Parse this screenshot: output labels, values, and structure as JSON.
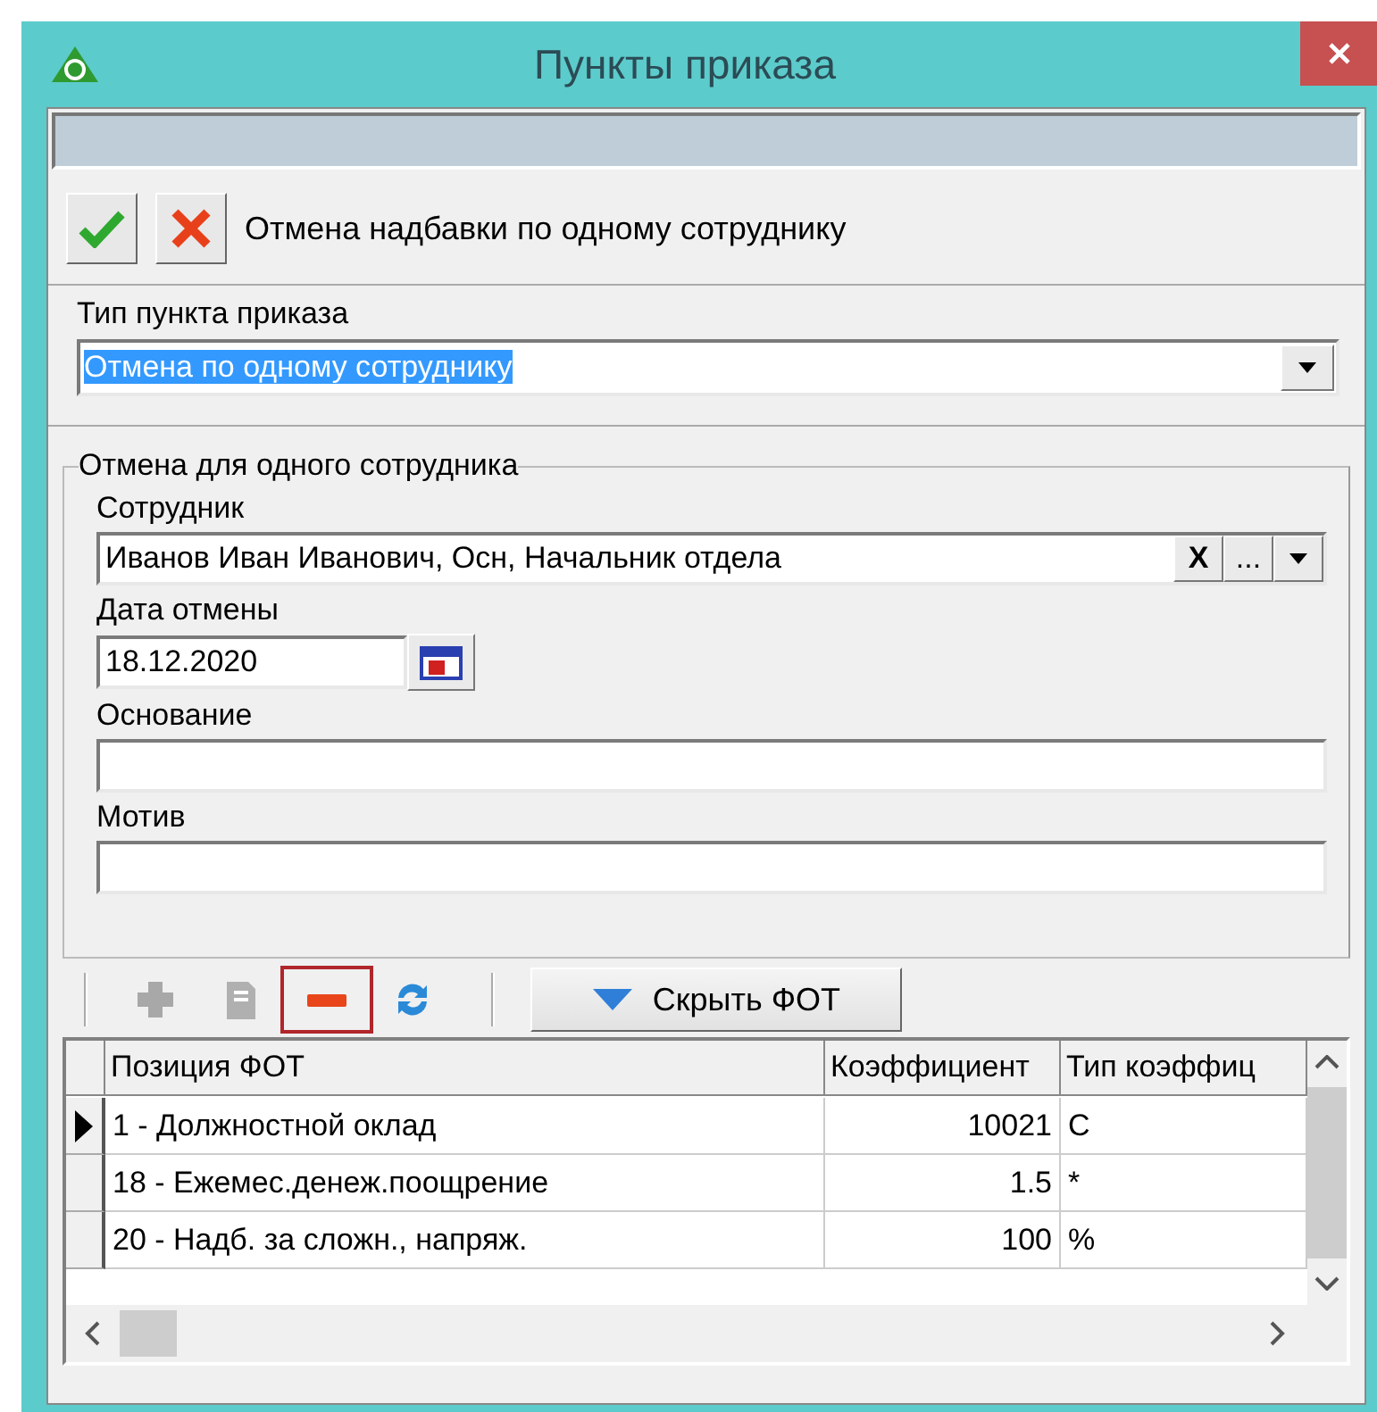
{
  "window": {
    "title": "Пункты приказа"
  },
  "header": {
    "caption": "Отмена надбавки по одному сотруднику"
  },
  "order_type": {
    "label": "Тип пункта приказа",
    "value": "Отмена по одному сотруднику",
    "text_selected": true
  },
  "group": {
    "title": "Отмена для одного сотрудника",
    "fields": [
      {
        "kind": "lookup",
        "label": "Сотрудник",
        "value": "Иванов Иван Иванович, Осн, Начальник отдела",
        "clear_button": "X",
        "browse_button": "..."
      },
      {
        "kind": "date",
        "label": "Дата отмены",
        "value": "18.12.2020"
      },
      {
        "kind": "text",
        "label": "Основание"
      },
      {
        "kind": "text",
        "label": "Мотив"
      }
    ]
  },
  "toolbar": {
    "items": [
      {
        "kind": "add",
        "disabled": true,
        "highlighted": false
      },
      {
        "kind": "edit",
        "disabled": true,
        "highlighted": false
      },
      {
        "kind": "remove",
        "disabled": false,
        "highlighted": true
      },
      {
        "kind": "refresh",
        "disabled": false,
        "highlighted": false
      }
    ],
    "toggle_button": "Скрыть ФОТ"
  },
  "grid": {
    "columns": [
      "Позиция ФОТ",
      "Коэффициент",
      "Тип коэффиц"
    ],
    "rows": [
      {
        "cells": [
          "1 - Должностной оклад",
          "10021",
          "С"
        ],
        "selected": true
      },
      {
        "cells": [
          "18 - Ежемес.денеж.поощрение",
          "1.5",
          "*"
        ],
        "selected": false
      },
      {
        "cells": [
          "20 - Надб. за сложн., напряж.",
          "100",
          "%"
        ],
        "selected": false
      }
    ]
  }
}
